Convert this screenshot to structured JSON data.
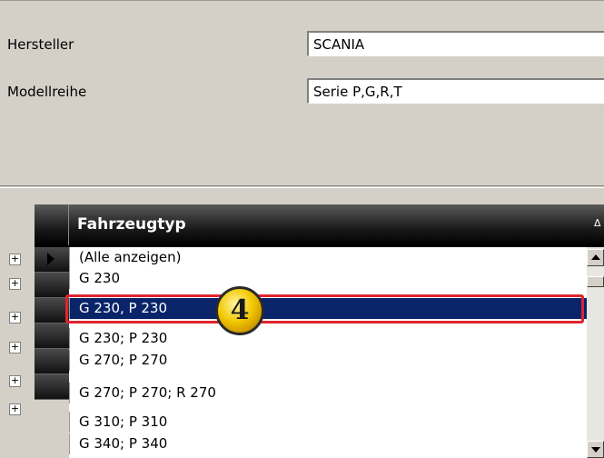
{
  "form": {
    "hersteller_label": "Hersteller",
    "hersteller_value": "SCANIA",
    "modellreihe_label": "Modellreihe",
    "modellreihe_value": "Serie P,G,R,T"
  },
  "grid": {
    "column_header": "Fahrzeugtyp",
    "sort_symbol": "Δ",
    "selected_row_index": 2,
    "rows": [
      "(Alle anzeigen)",
      "G 230",
      "G 230, P 230",
      "G 230; P 230",
      "G 270; P 270",
      "G 270; P 270; R 270",
      "G 310; P 310",
      "G 340; P 340"
    ],
    "expander_symbol": "+"
  },
  "annotation": {
    "step_number": "4",
    "outline_color": "#e0242f",
    "badge_color": "#f2c800"
  },
  "colors": {
    "selection_bg": "#0a246a",
    "panel_bg": "#d4d0c8",
    "filter_icon": "#3399ff"
  }
}
